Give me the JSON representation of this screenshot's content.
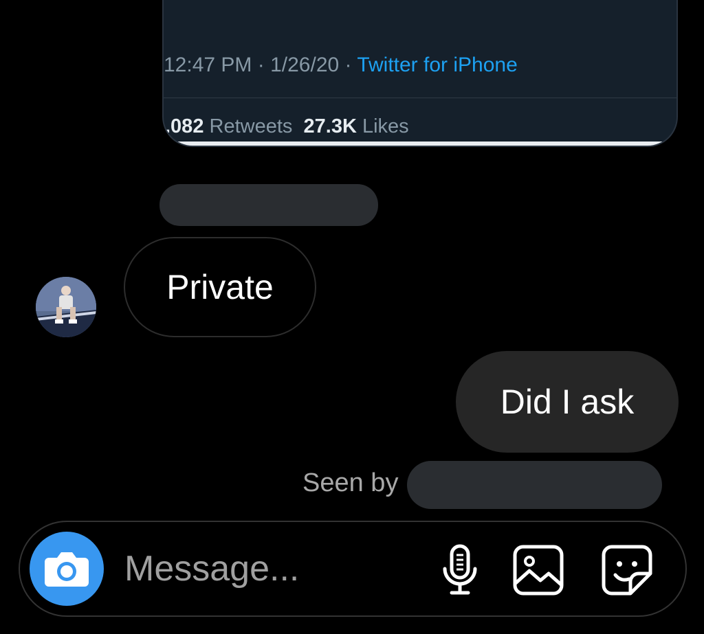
{
  "shared_tweet": {
    "time": "12:47 PM",
    "sep1": " · ",
    "date": "1/26/20",
    "sep2": " · ",
    "source": "Twitter for iPhone",
    "retweets_count": ".082",
    "retweets_label": " Retweets  ",
    "likes_count": "27.3K",
    "likes_label": " Likes"
  },
  "messages": [
    {
      "direction": "incoming",
      "text": "Private"
    },
    {
      "direction": "outgoing",
      "text": "Did I ask"
    }
  ],
  "seen": {
    "label": "Seen by"
  },
  "composer": {
    "placeholder": "Message...",
    "accent_color": "#3897f0",
    "icons": [
      "camera-icon",
      "microphone-icon",
      "gallery-icon",
      "sticker-icon"
    ]
  },
  "colors": {
    "background": "#000000",
    "tweet_card": "#15202b",
    "twitter_blue": "#1da1f2",
    "outgoing_bubble": "#262626",
    "redaction": "#2a2d31"
  }
}
